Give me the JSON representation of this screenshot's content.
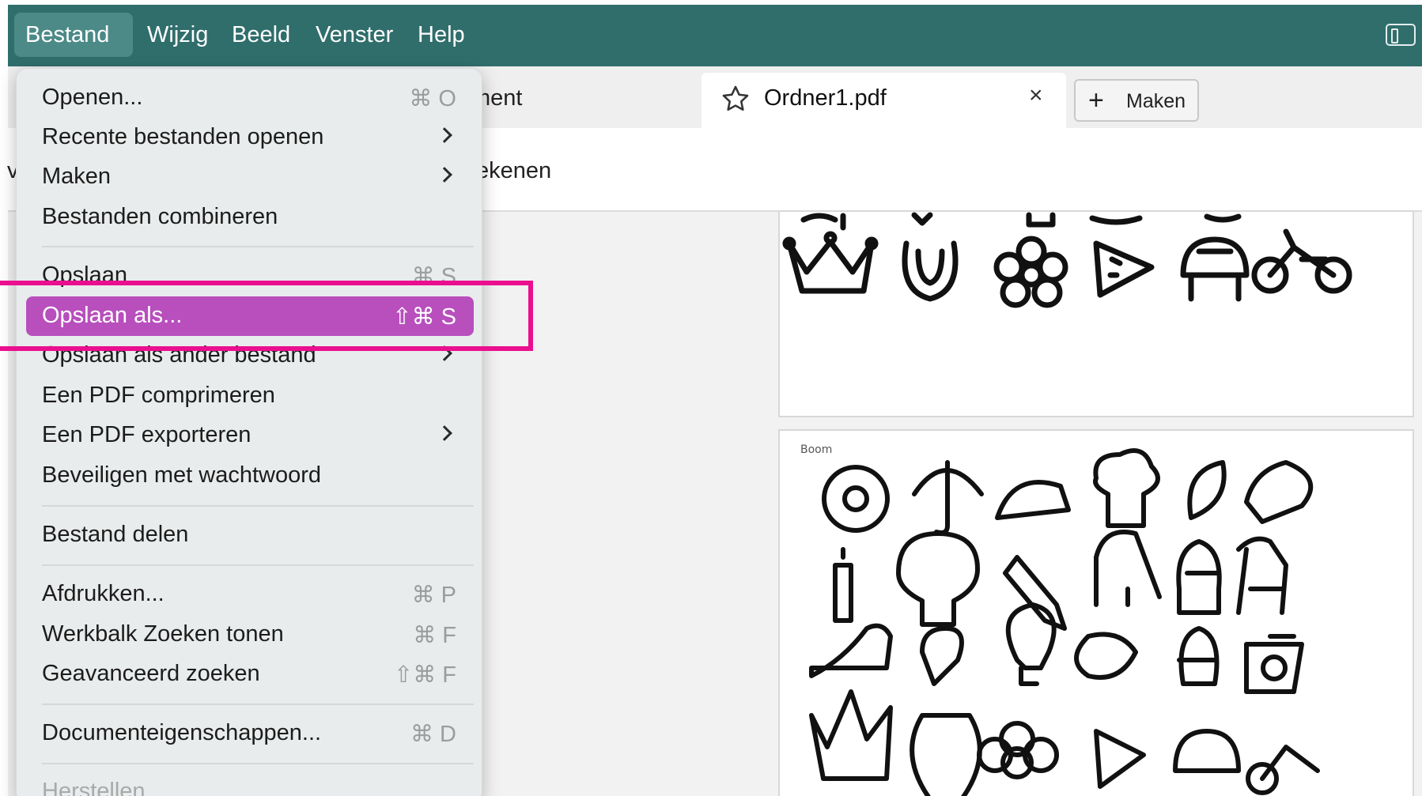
{
  "menubar": {
    "items": [
      {
        "label": "Bestand",
        "active": true
      },
      {
        "label": "Wijzig"
      },
      {
        "label": "Beeld"
      },
      {
        "label": "Venster"
      },
      {
        "label": "Help"
      }
    ],
    "right_icon": "sidebar-toggle-icon"
  },
  "tabs": {
    "behind_fragment": "ment",
    "active": {
      "title": "Ordner1.pdf",
      "star_icon": "star-icon",
      "close": "×"
    },
    "make_button": {
      "plus": "+",
      "label": "Maken"
    }
  },
  "toolbar": {
    "left_fragment": "v",
    "fragment": "ekenen"
  },
  "document": {
    "page2_label": "Boom"
  },
  "menu": {
    "items": [
      {
        "label": "Openen...",
        "shortcut": "⌘ O"
      },
      {
        "label": "Recente bestanden openen",
        "submenu": true
      },
      {
        "label": "Maken",
        "submenu": true
      },
      {
        "label": "Bestanden combineren"
      },
      {
        "label": "Opslaan",
        "shortcut": "⌘ S"
      },
      {
        "label": "Opslaan als...",
        "shortcut": "⇧⌘ S",
        "selected": true
      },
      {
        "label": "Opslaan als ander bestand",
        "submenu": true
      },
      {
        "label": "Een PDF comprimeren"
      },
      {
        "label": "Een PDF exporteren",
        "submenu": true
      },
      {
        "label": "Beveiligen met wachtwoord"
      },
      {
        "label": "Bestand delen"
      },
      {
        "label": "Afdrukken...",
        "shortcut": "⌘ P"
      },
      {
        "label": "Werkbalk Zoeken tonen",
        "shortcut": "⌘ F"
      },
      {
        "label": "Geavanceerd zoeken",
        "shortcut": "⇧⌘ F"
      },
      {
        "label": "Documenteigenschappen...",
        "shortcut": "⌘ D"
      },
      {
        "label": "Herstellen",
        "disabled": true
      }
    ]
  },
  "annotation": {
    "highlight_color": "#ea0f8f"
  },
  "colors": {
    "menubar": "#306e6c",
    "selected": "#b84fbd"
  }
}
